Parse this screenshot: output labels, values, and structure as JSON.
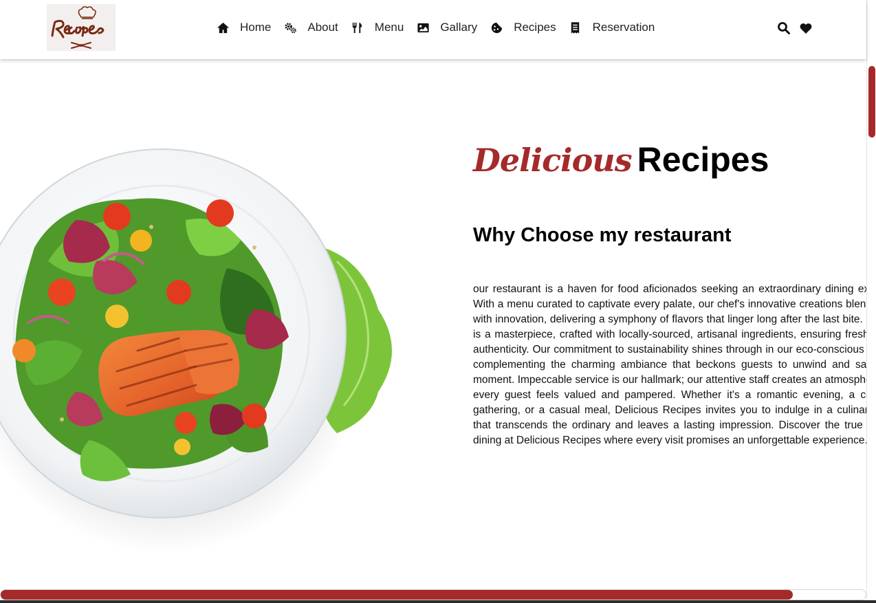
{
  "header": {
    "logo_text": "Recipes",
    "nav": [
      {
        "label": "Home",
        "icon": "home-icon"
      },
      {
        "label": "About",
        "icon": "gears-icon"
      },
      {
        "label": "Menu",
        "icon": "utensils-icon"
      },
      {
        "label": "Gallary",
        "icon": "image-icon"
      },
      {
        "label": "Recipes",
        "icon": "cookie-icon"
      },
      {
        "label": "Reservation",
        "icon": "receipt-icon"
      }
    ],
    "actions": [
      {
        "icon": "search-icon"
      },
      {
        "icon": "heart-icon"
      }
    ]
  },
  "hero": {
    "title_accent": "Delicious",
    "title_main": "Recipes",
    "subheading": "Why Choose my restaurant",
    "paragraph": "our restaurant is a haven for food aficionados seeking an extraordinary dining experience. With a menu curated to captivate every palate, our chef's innovative creations blend tradition with innovation, delivering a symphony of flavors that linger long after the last bite. Each dish is a masterpiece, crafted with locally-sourced, artisanal ingredients, ensuring freshness and authenticity. Our commitment to sustainability shines through in our eco-conscious practices, complementing the charming ambiance that beckons guests to unwind and savor every moment. Impeccable service is our hallmark; our attentive staff creates an atmosphere where every guest feels valued and pampered. Whether it's a romantic evening, a celebratory gathering, or a casual meal, Delicious Recipes invites you to indulge in a culinary journey that transcends the ordinary and leaves a lasting impression. Discover the true artistry of dining at Delicious Recipes where every visit promises an unforgettable experience.\"",
    "image": "salmon-salad-plate"
  },
  "colors": {
    "accent": "#a52a2a",
    "text": "#111111",
    "header_bg": "#ffffff"
  }
}
